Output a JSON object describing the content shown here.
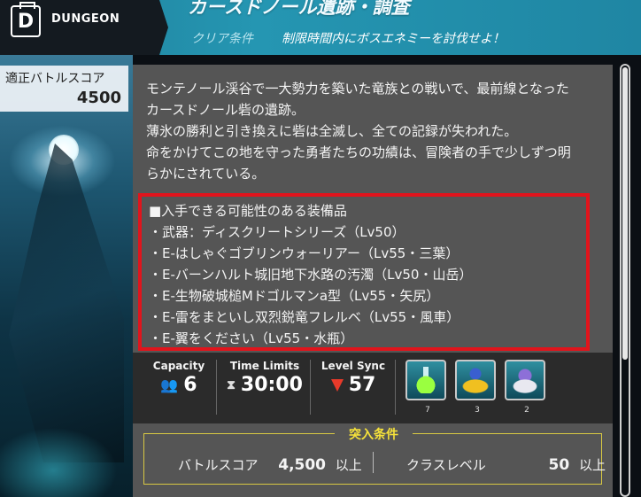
{
  "header": {
    "section_label": "DUNGEON",
    "icon_letter": "D",
    "title": "カースドノール遺跡・調査",
    "clear_condition_label": "クリア条件",
    "clear_condition_text": "制限時間内にボスエネミーを討伐せよ！",
    "accent_color": "#2596b2"
  },
  "recommended": {
    "label": "適正バトルスコア",
    "value": "4500"
  },
  "description": [
    "モンテノール渓谷で一大勢力を築いた竜族との戦いで、最前線となった",
    "カースドノール砦の遺跡。",
    "薄氷の勝利と引き換えに砦は全滅し、全ての記録が失われた。",
    "命をかけてこの地を守った勇者たちの功績は、冒険者の手で少しずつ明",
    "らかにされている。"
  ],
  "equipment": {
    "heading": "■入手できる可能性のある装備品",
    "items": [
      "・武器：ディスクリートシリーズ（Lv50）",
      "・E-はしゃぐゴブリンウォーリアー（Lv55・三葉）",
      "・E-バーンハルト城旧地下水路の汚濁（Lv50・山岳）",
      "・E-生物破城槌Mドゴルマンa型（Lv55・矢尻）",
      "・E-雷をまといし双烈鋭竜フレルベ（Lv55・風車）",
      "・E-翼をください（Lv55・水瓶）"
    ],
    "highlight_color": "#e1141c"
  },
  "stats": {
    "capacity_label": "Capacity",
    "capacity_value": "6",
    "time_label": "Time Limits",
    "time_value": "30:00",
    "level_label": "Level Sync",
    "level_value": "57"
  },
  "rewards": [
    {
      "icon": "green-flask-icon",
      "count": "7"
    },
    {
      "icon": "golden-lamp-icon",
      "count": "3"
    },
    {
      "icon": "pillow-emblem-icon",
      "count": "2"
    }
  ],
  "entry_conditions": {
    "title": "突入条件",
    "score_label": "バトルスコア",
    "score_value": "4,500",
    "score_suffix": "以上",
    "class_label": "クラスレベル",
    "class_value": "50",
    "class_suffix": "以上",
    "title_color": "#f6e23a"
  }
}
